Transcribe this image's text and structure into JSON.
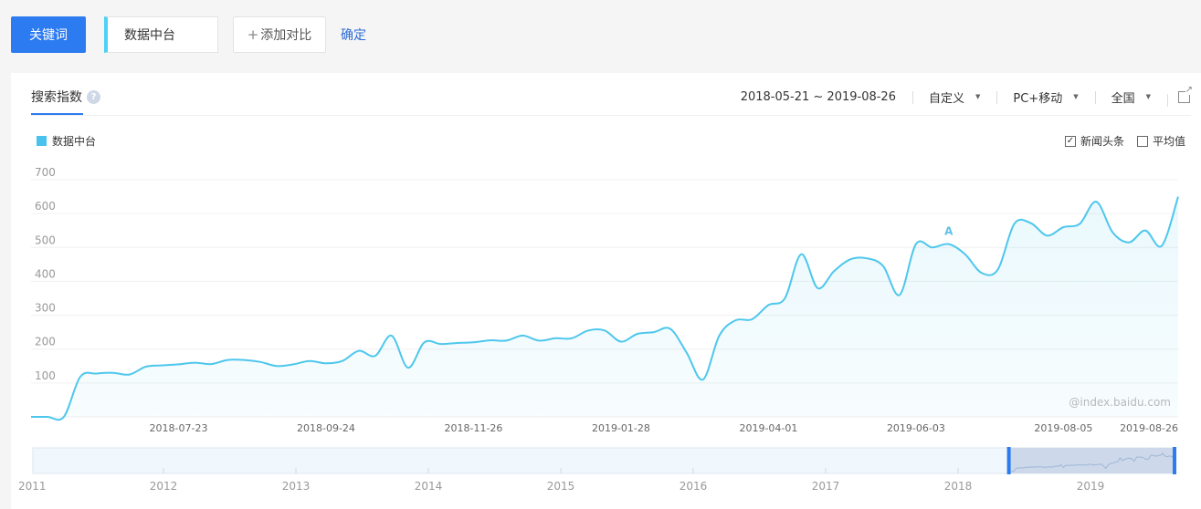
{
  "toolbar": {
    "keyword_button": "关键词",
    "keyword_value": "数据中台",
    "add_compare": "添加对比",
    "confirm": "确定"
  },
  "panel": {
    "tab": "搜索指数",
    "help": "?",
    "filters": {
      "date_range": "2018-05-21 ~ 2019-08-26",
      "period": "自定义",
      "device": "PC+移动",
      "region": "全国"
    },
    "options": {
      "news": {
        "label": "新闻头条",
        "checked": true
      },
      "average": {
        "label": "平均值",
        "checked": false
      }
    },
    "watermark": "@index.baidu.com"
  },
  "colors": {
    "accent": "#2d7bf0",
    "series": "#4ec7ec"
  },
  "chart_data": {
    "type": "area",
    "series": [
      {
        "name": "数据中台",
        "start_date": "2018-05-21",
        "step_days": 7,
        "values": [
          0,
          0,
          0,
          118,
          128,
          130,
          125,
          148,
          152,
          155,
          160,
          156,
          168,
          168,
          162,
          150,
          155,
          165,
          158,
          165,
          195,
          180,
          240,
          145,
          220,
          215,
          218,
          220,
          226,
          225,
          240,
          225,
          232,
          232,
          255,
          255,
          222,
          245,
          250,
          260,
          190,
          110,
          240,
          285,
          288,
          330,
          350,
          480,
          380,
          430,
          465,
          468,
          445,
          360,
          510,
          500,
          510,
          480,
          425,
          435,
          570,
          572,
          535,
          560,
          570,
          635,
          545,
          515,
          550,
          505,
          650
        ]
      }
    ],
    "x_tick_labels": [
      "2018-07-23",
      "2018-09-24",
      "2018-11-26",
      "2019-01-28",
      "2019-04-01",
      "2019-06-03",
      "2019-08-05",
      "2019-08-26"
    ],
    "y_ticks": [
      100,
      200,
      300,
      400,
      500,
      600,
      700
    ],
    "ylim": [
      0,
      700
    ],
    "annotations": [
      {
        "label": "A",
        "date": "2019-06-17"
      }
    ],
    "overview_axis": [
      "2011",
      "2012",
      "2013",
      "2014",
      "2015",
      "2016",
      "2017",
      "2018",
      "2019"
    ],
    "overview_selection": [
      "2018-05-21",
      "2019-08-26"
    ]
  }
}
